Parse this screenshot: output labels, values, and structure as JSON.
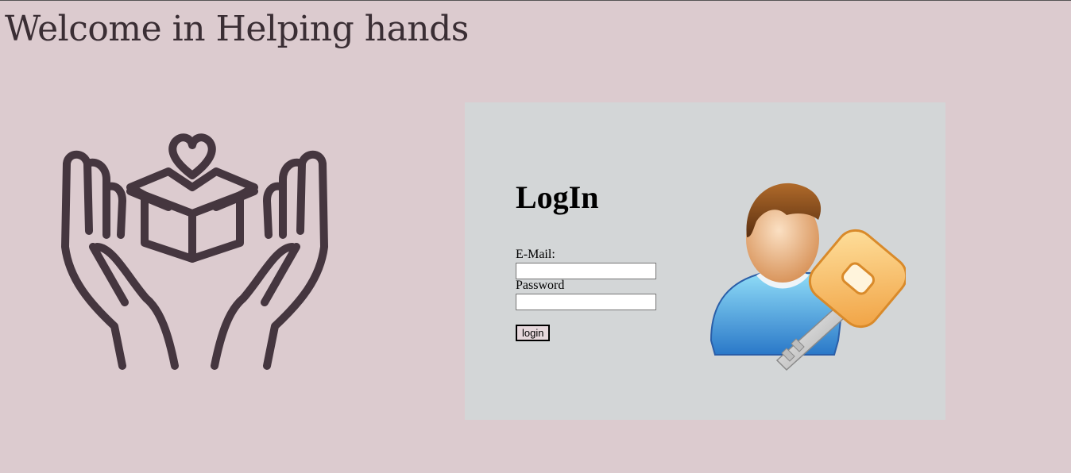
{
  "header": {
    "title": "Welcome in Helping hands"
  },
  "logo": {
    "icon": "helping-hands-box-heart-icon",
    "color": "#45363f"
  },
  "login": {
    "heading": "LogIn",
    "email_label": "E-Mail:",
    "email_value": "",
    "password_label": "Password",
    "password_value": "",
    "submit_label": "login",
    "illustration_icon": "user-with-key-icon"
  },
  "colors": {
    "page_background": "#dccbcf",
    "panel_background": "#d3d6d7",
    "button_background": "#e6d8dc"
  }
}
